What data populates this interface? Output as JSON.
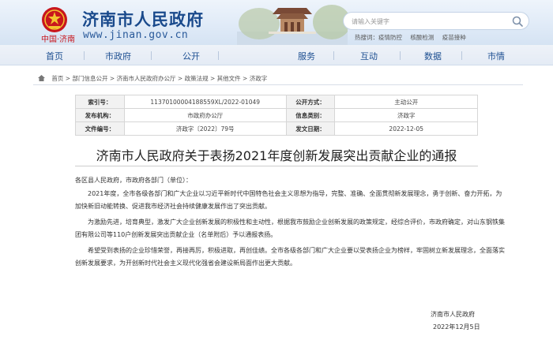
{
  "header": {
    "title": "济南市人民政府",
    "url": "www.jinan.gov.cn",
    "china_mark": "中国·济南",
    "search_placeholder": "请输入关键字",
    "hot_links": [
      "热搜词：疫情防控",
      "核酸检测",
      "疫苗接种"
    ]
  },
  "nav": {
    "items": [
      "首页",
      "市政府",
      "公开",
      "服务",
      "互动",
      "数据",
      "市情"
    ]
  },
  "breadcrumb": {
    "items": [
      "首页",
      "部门信息公开",
      "济南市人民政府办公厅",
      "政策法规",
      "其他文件",
      "济政字"
    ],
    "separator": " > "
  },
  "info": {
    "rows": [
      {
        "label1": "索引号：",
        "value1": "11370100004188559XL/2022-01049",
        "label2": "公开方式：",
        "value2": "主动公开"
      },
      {
        "label1": "发布机构：",
        "value1": "市政府办公厅",
        "label2": "信息类别：",
        "value2": "济政字"
      },
      {
        "label1": "文件编号：",
        "value1": "济政字〔2022〕79号",
        "label2": "发文日期：",
        "value2": "2022-12-05"
      }
    ]
  },
  "doc": {
    "title": "济南市人民政府关于表扬2021年度创新发展突出贡献企业的通报",
    "salutation": "各区县人民政府，市政府各部门（单位）：",
    "paragraphs": [
      "2021年度，全市各级各部门和广大企业以习近平新时代中国特色社会主义思想为指导，完整、准确、全面贯彻新发展理念，勇于创新、奋力开拓，为加快新旧动能转换、促进我市经济社会持续健康发展作出了突出贡献。",
      "为激励先进，培育典型，激发广大企业创新发展的积极性和主动性，根据我市鼓励企业创新发展的政策规定，经综合评价，市政府确定，对山东钢铁集团有限公司等110户创新发展突出贡献企业（名单附后）予以通报表扬。",
      "希望受到表扬的企业珍惜荣誉，再接再厉，积极进取，再创佳绩。全市各级各部门和广大企业要以受表扬企业为榜样，牢固树立新发展理念，全面落实创新发展要求，为开创新时代社会主义现代化强省会建设新局面作出更大贡献。"
    ],
    "signature": "济南市人民政府",
    "date": "2022年12月5日"
  },
  "colors": {
    "brand_blue": "#1a4a8c",
    "nav_text": "#1d4f91",
    "emblem_red": "#c8161d",
    "emblem_gold": "#f4c430"
  }
}
